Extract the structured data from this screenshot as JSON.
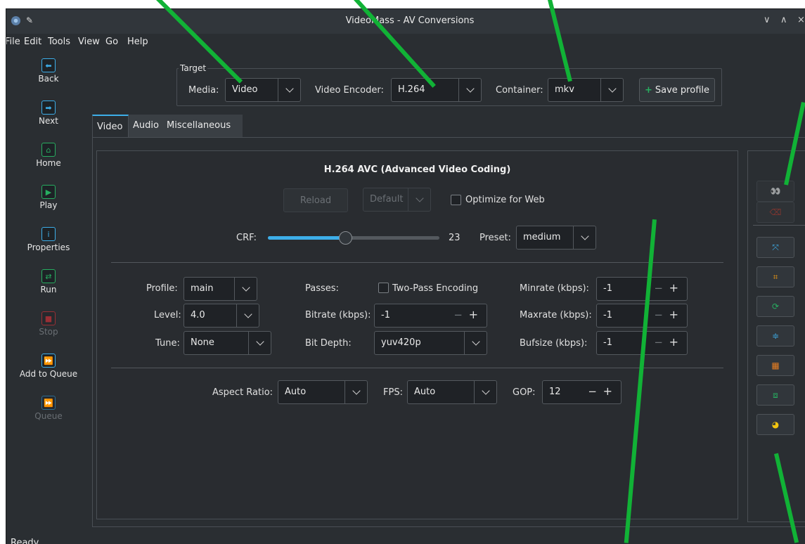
{
  "window": {
    "title": "VideoMass - AV Conversions",
    "controls": {
      "minimize": "∨",
      "maximize": "∧",
      "close": "×"
    }
  },
  "menubar": [
    "File",
    "Edit",
    "Tools",
    "View",
    "Go",
    "Help"
  ],
  "sidebar": {
    "items": [
      {
        "label": "Back",
        "icon": "back-arrow-icon",
        "glyph": "⬅",
        "color": "#3daee9",
        "enabled": true
      },
      {
        "label": "Next",
        "icon": "next-arrow-icon",
        "glyph": "➡",
        "color": "#3daee9",
        "enabled": true
      },
      {
        "label": "Home",
        "icon": "home-icon",
        "glyph": "⌂",
        "color": "#27ae60",
        "enabled": true
      },
      {
        "label": "Play",
        "icon": "play-icon",
        "glyph": "▶",
        "color": "#27ae60",
        "enabled": true
      },
      {
        "label": "Properties",
        "icon": "properties-icon",
        "glyph": "i",
        "color": "#3daee9",
        "enabled": true
      },
      {
        "label": "Run",
        "icon": "run-icon",
        "glyph": "⇄",
        "color": "#27ae60",
        "enabled": true
      },
      {
        "label": "Stop",
        "icon": "stop-icon",
        "glyph": "■",
        "color": "#9a2f35",
        "enabled": false
      },
      {
        "label": "Add to Queue",
        "icon": "add-to-queue-icon",
        "glyph": "⏩",
        "color": "#3daee9",
        "enabled": true
      },
      {
        "label": "Queue",
        "icon": "queue-icon",
        "glyph": "⏩",
        "color": "#2d6d94",
        "enabled": false
      }
    ]
  },
  "target": {
    "legend": "Target",
    "media_label": "Media:",
    "media_value": "Video",
    "encoder_label": "Video Encoder:",
    "encoder_value": "H.264",
    "container_label": "Container:",
    "container_value": "mkv",
    "save_profile_label": "Save profile"
  },
  "tabs": [
    "Video",
    "Audio",
    "Miscellaneous"
  ],
  "video": {
    "heading": "H.264 AVC (Advanced Video Coding)",
    "reload_label": "Reload",
    "default_value": "Default",
    "optimize_web_label": "Optimize for Web",
    "crf_label": "CRF:",
    "crf_value": "23",
    "crf_level": 0.45,
    "preset_label": "Preset:",
    "preset_value": "medium",
    "profile_label": "Profile:",
    "profile_value": "main",
    "level_label": "Level:",
    "level_value": "4.0",
    "tune_label": "Tune:",
    "tune_value": "None",
    "passes_label": "Passes:",
    "two_pass_label": "Two-Pass Encoding",
    "bitrate_label": "Bitrate (kbps):",
    "bitrate_value": "-1",
    "bit_depth_label": "Bit Depth:",
    "bit_depth_value": "yuv420p",
    "minrate_label": "Minrate (kbps):",
    "minrate_value": "-1",
    "maxrate_label": "Maxrate (kbps):",
    "maxrate_value": "-1",
    "bufsize_label": "Bufsize (kbps):",
    "bufsize_value": "-1",
    "aspect_label": "Aspect Ratio:",
    "aspect_value": "Auto",
    "fps_label": "FPS:",
    "fps_value": "Auto",
    "gop_label": "GOP:",
    "gop_value": "12"
  },
  "right_tools": [
    {
      "icon": "preview-icon",
      "glyph": "👀",
      "color": "#bbbbbb",
      "enabled": false
    },
    {
      "icon": "clear-filters-icon",
      "glyph": "⌫",
      "color": "#c0392b",
      "enabled": false
    },
    {
      "icon": "resize-icon",
      "glyph": "⤧",
      "color": "#3daee9",
      "enabled": true
    },
    {
      "icon": "crop-icon",
      "glyph": "⌗",
      "color": "#f39c12",
      "enabled": true
    },
    {
      "icon": "rotate-icon",
      "glyph": "⟳",
      "color": "#27ae60",
      "enabled": true
    },
    {
      "icon": "deinterlace-icon",
      "glyph": "≑",
      "color": "#3daee9",
      "enabled": true
    },
    {
      "icon": "denoise-icon",
      "glyph": "▦",
      "color": "#e67e22",
      "enabled": true
    },
    {
      "icon": "stabilize-icon",
      "glyph": "⧈",
      "color": "#27ae60",
      "enabled": true
    },
    {
      "icon": "color-correction-icon",
      "glyph": "◕",
      "color": "#f1c40f",
      "enabled": true
    }
  ],
  "status": "Ready"
}
